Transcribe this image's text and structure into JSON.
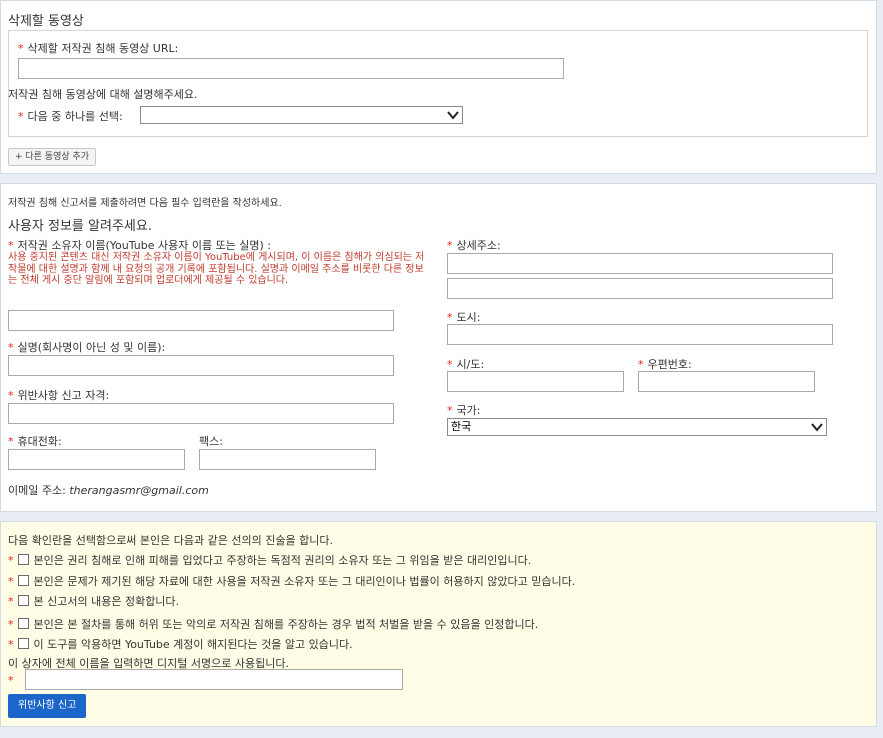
{
  "video_section": {
    "title": "삭제할 동영상",
    "url_label": "삭제할 저작권 침해 동영상 URL:",
    "url_value": "",
    "describe_label": "저작권 침해 동영상에 대해 설명해주세요.",
    "choose_label": "다음 중 하나를 선택:",
    "choose_value": "",
    "add_button": "+ 다른 동영상 추가"
  },
  "info_section": {
    "intro": "저작권 침해 신고서를 제출하려면 다음 필수 입력란을 작성하세요.",
    "title": "사용자 정보를 알려주세요.",
    "owner_label": "저작권 소유자 이름(YouTube 사용자 이름 또는 실명) :",
    "owner_warning": "사용 중지된 콘텐츠 대신 저작권 소유자 이름이 YouTube에 게시되며, 이 이름은 침해가 의심되는 저작물에 대한 설명과 함께 내 요청의 공개 기록에 포함됩니다. 실명과 이메일 주소를 비롯한 다른 정보는 전체 게시 중단 알림에 포함되며 업로더에게 제공될 수 있습니다.",
    "realname_label": "실명(회사명이 아닌 성 및 이름):",
    "authority_label": "위반사항 신고 자격:",
    "phone_label": "휴대전화:",
    "fax_label": "팩스:",
    "email_label": "이메일 주소:",
    "email_value": "therangasmr@gmail.com",
    "address_label": "상세주소:",
    "city_label": "도시:",
    "state_label": "시/도:",
    "zip_label": "우편번호:",
    "country_label": "국가:",
    "country_value": "한국"
  },
  "statements_section": {
    "intro": "다음 확인란을 선택함으로써 본인은 다음과 같은 선의의 진술을 합니다.",
    "items": [
      "본인은 권리 침해로 인해 피해를 입었다고 주장하는 독점적 권리의 소유자 또는 그 위임을 받은 대리인입니다.",
      "본인은 문제가 제기된 해당 자료에 대한 사용을 저작권 소유자 또는 그 대리인이나 법률이 허용하지 않았다고 믿습니다.",
      "본 신고서의 내용은 정확합니다.",
      "본인은 본 절차를 통해 허위 또는 악의로 저작권 침해를 주장하는 경우 법적 처벌을 받을 수 있음을 인정합니다.",
      "이 도구를 악용하면 YouTube 계정이 해지된다는 것을 알고 있습니다."
    ],
    "signature_label": "이 상자에 전체 이름을 입력하면 디지털 서명으로 사용됩니다.",
    "signature_value": "",
    "submit_button": "위반사항 신고"
  },
  "colors": {
    "required": "#dd2222",
    "warning": "#c0392b",
    "submit": "#1c66c9",
    "statements_bg": "#fffde6"
  }
}
